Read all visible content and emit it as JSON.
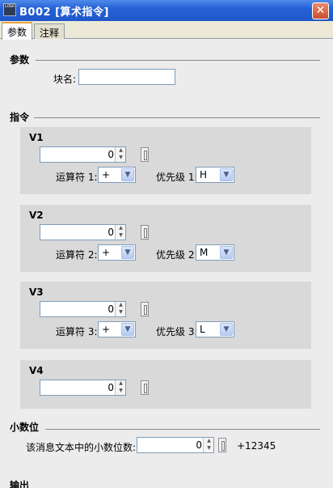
{
  "window": {
    "icon_text": "LOGO",
    "title": "B002 [算术指令]",
    "close_glyph": "✕"
  },
  "tabs": [
    {
      "label": "参数",
      "active": true
    },
    {
      "label": "注释",
      "active": false
    }
  ],
  "params": {
    "heading": "参数",
    "block_name_label": "块名:",
    "block_name_value": ""
  },
  "instructions": {
    "heading": "指令",
    "groups": [
      {
        "title": "V1",
        "value": "0",
        "operator_label": "运算符 1:",
        "operator": "+",
        "priority_label": "优先级 1:",
        "priority": "H"
      },
      {
        "title": "V2",
        "value": "0",
        "operator_label": "运算符 2:",
        "operator": "+",
        "priority_label": "优先级 2:",
        "priority": "M"
      },
      {
        "title": "V3",
        "value": "0",
        "operator_label": "运算符 3:",
        "operator": "+",
        "priority_label": "优先级 3:",
        "priority": "L"
      },
      {
        "title": "V4",
        "value": "0"
      }
    ]
  },
  "decimals": {
    "heading": "小数位",
    "label": "该消息文本中的小数位数:",
    "value": "0",
    "preview": "+12345"
  },
  "output": {
    "heading": "输出"
  },
  "glyphs": {
    "spin_up": "▲",
    "spin_down": "▼",
    "dropdown": "▼"
  },
  "colors": {
    "titlebar": "#2561d7",
    "background": "#ececec",
    "group_background": "#d9d9d9",
    "active_tab_accent": "#e8a43a"
  }
}
